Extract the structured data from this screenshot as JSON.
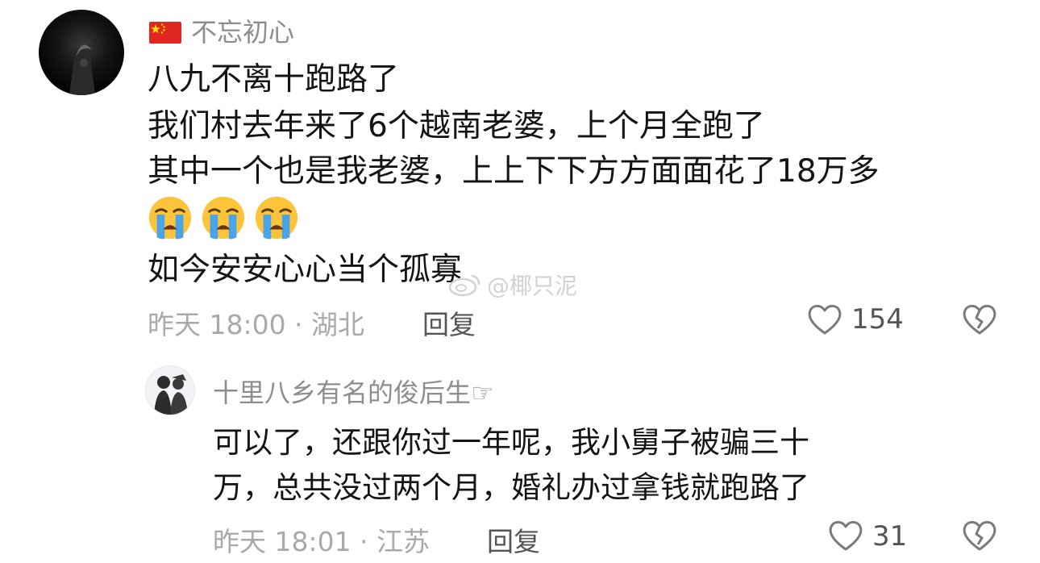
{
  "comment": {
    "username": "不忘初心",
    "flag_icon": "china-flag-icon",
    "lines": [
      "八九不离十跑路了",
      "我们村去年来了6个越南老婆，上个月全跑了",
      "其中一个也是我老婆，上上下下方方面面花了18万多"
    ],
    "emoji_icon": "loudly-crying-face-icon",
    "emoji_count": 3,
    "last_line": "如今安安心心当个孤寡",
    "meta": "昨天 18:00 · 湖北",
    "reply_label": "回复",
    "like_count": "154"
  },
  "reply": {
    "username": "十里八乡有名的俊后生☞",
    "lines": [
      "可以了，还跟你过一年呢，我小舅子被骗三十",
      "万，总共没过两个月，婚礼办过拿钱就跑路了"
    ],
    "meta": "昨天 18:01 · 江苏",
    "reply_label": "回复",
    "like_count": "31"
  },
  "watermark": {
    "text": "@椰只泥",
    "icon": "weibo-logo-icon"
  },
  "colors": {
    "username": "#8d8d8d",
    "body_text": "#141414",
    "meta_text": "#a9a9a9",
    "action_text": "#555555",
    "flag_red": "#e0271f",
    "flag_star": "#ffde00"
  }
}
